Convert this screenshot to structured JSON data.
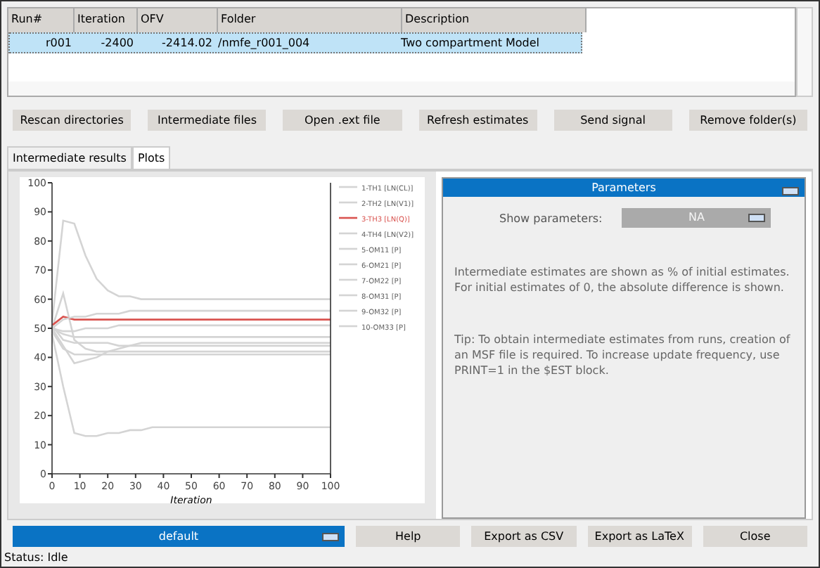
{
  "table": {
    "columns": [
      "Run#",
      "Iteration",
      "OFV",
      "Folder",
      "Description"
    ],
    "rows": [
      {
        "selected": true,
        "cells": [
          "r001",
          "-2400",
          "-2414.02",
          "/nmfe_r001_004",
          "Two compartment Model"
        ]
      }
    ]
  },
  "toolbar": [
    "Rescan directories",
    "Intermediate files",
    "Open .ext file",
    "Refresh estimates",
    "Send signal",
    "Remove folder(s)"
  ],
  "tabs": [
    {
      "label": "Intermediate results",
      "selected": false
    },
    {
      "label": "Plots",
      "selected": true
    }
  ],
  "chart_data": {
    "type": "line",
    "legend": true,
    "xlabel": "Iteration",
    "x": [
      0,
      4,
      8,
      12,
      16,
      20,
      24,
      28,
      32,
      36,
      40,
      100
    ],
    "xlim": [
      0,
      100
    ],
    "ylim": [
      0,
      100
    ],
    "xticks": [
      0,
      10,
      20,
      30,
      40,
      50,
      60,
      70,
      80,
      90,
      100
    ],
    "yticks": [
      0,
      10,
      20,
      30,
      40,
      50,
      60,
      70,
      80,
      90,
      100
    ],
    "series": [
      {
        "name": "1-TH1 [LN(CL)]",
        "color": "#d4d4d4",
        "values": [
          52,
          87,
          86,
          75,
          67,
          63,
          61,
          61,
          60,
          60,
          60,
          60
        ]
      },
      {
        "name": "2-TH2 [LN(V1)]",
        "color": "#d4d4d4",
        "values": [
          50,
          62,
          46,
          43,
          42,
          42,
          42,
          42,
          42,
          42,
          42,
          42
        ]
      },
      {
        "name": "3-TH3 [LN(Q)]",
        "color": "#d9534f",
        "values": [
          51,
          54,
          53,
          53,
          53,
          53,
          53,
          53,
          53,
          53,
          53,
          53
        ]
      },
      {
        "name": "4-TH4 [LN(V2)]",
        "color": "#d4d4d4",
        "values": [
          50,
          53,
          54,
          54,
          55,
          55,
          55,
          56,
          56,
          56,
          56,
          56
        ]
      },
      {
        "name": "5-OM11 [P]",
        "color": "#d4d4d4",
        "values": [
          50,
          49,
          49,
          50,
          50,
          50,
          51,
          51,
          51,
          51,
          51,
          51
        ]
      },
      {
        "name": "6-OM21 [P]",
        "color": "#d4d4d4",
        "values": [
          50,
          44,
          38,
          39,
          40,
          42,
          43,
          44,
          45,
          45,
          45,
          45
        ]
      },
      {
        "name": "7-OM22 [P]",
        "color": "#d4d4d4",
        "values": [
          49,
          43,
          41,
          41,
          41,
          41,
          41,
          41,
          41,
          41,
          41,
          41
        ]
      },
      {
        "name": "8-OM31 [P]",
        "color": "#d4d4d4",
        "values": [
          50,
          48,
          47,
          47,
          47,
          47,
          47,
          47,
          47,
          47,
          47,
          47
        ]
      },
      {
        "name": "9-OM32 [P]",
        "color": "#d4d4d4",
        "values": [
          48,
          30,
          14,
          13,
          13,
          14,
          14,
          15,
          15,
          16,
          16,
          16
        ]
      },
      {
        "name": "10-OM33 [P]",
        "color": "#d4d4d4",
        "values": [
          51,
          46,
          45,
          45,
          45,
          45,
          44,
          44,
          44,
          44,
          44,
          44
        ]
      }
    ]
  },
  "parameters": {
    "title": "Parameters",
    "show_label": "Show parameters:",
    "show_value": "NA",
    "show_disabled": true,
    "notes": [
      "Intermediate estimates are shown as % of initial estimates. For initial estimates of 0, the absolute difference is shown.",
      "Tip: To obtain intermediate estimates from runs, creation of an MSF file is required. To increase update frequency, use PRINT=1 in the $EST block."
    ]
  },
  "bottom": {
    "theme": "default",
    "buttons": [
      "Help",
      "Export as CSV",
      "Export as LaTeX",
      "Close"
    ]
  },
  "status_bar": "Status: Idle"
}
